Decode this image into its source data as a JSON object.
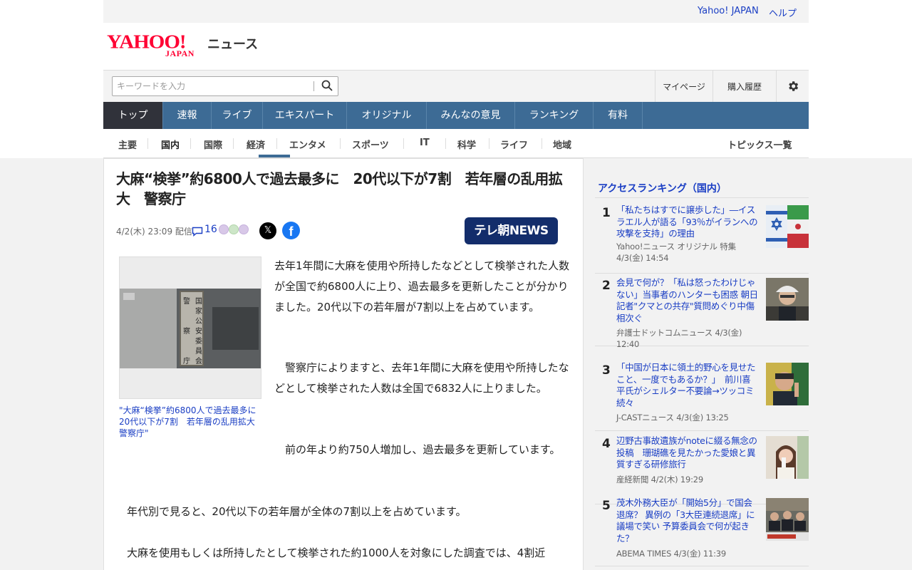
{
  "utility_links": [
    "Yahoo! JAPAN",
    "ヘルプ"
  ],
  "logo": {
    "yahoo": "YAHOO!",
    "japan": "JAPAN",
    "service": "ニュース"
  },
  "search": {
    "placeholder": "キーワードを入力",
    "icon": "search-icon"
  },
  "header_links": [
    "マイページ",
    "購入履歴"
  ],
  "settings_icon": "gear-icon",
  "main_nav": [
    "トップ",
    "速報",
    "ライブ",
    "エキスパート",
    "オリジナル",
    "みんなの意見",
    "ランキング",
    "有料"
  ],
  "main_nav_active": "トップ",
  "sub_nav": [
    "主要",
    "国内",
    "国際",
    "経済",
    "エンタメ",
    "スポーツ",
    "IT",
    "科学",
    "ライフ",
    "地域"
  ],
  "sub_nav_active": "国内",
  "topics_link": "トピックス一覧",
  "article": {
    "headline": "大麻“検挙”約6800人で過去最多に　20代以下が7割　若年層の乱用拡大　警察庁",
    "date": "4/2(木) 23:09 配信",
    "comment_count": "16",
    "media": "テレ朝NEWS",
    "caption": "\"大麻“検挙”約6800人で過去最多に　20代以下が7割　若年層の乱用拡大　警察庁\"",
    "paragraphs": [
      "去年1年間に大麻を使用や所持したなどとして検挙された人数が全国で約6800人に上り、過去最多を更新したことが分かりました。20代以下の若年層が7割以上を占めています。",
      "警察庁によりますと、去年1年間に大麻を使用や所持したなどとして検挙された人数は全国で6832人に上りました。",
      "前の年より約750人増加し、過去最多を更新しています。",
      "年代別で見ると、20代以下の若年層が全体の7割以上を占めています。",
      "大麻を使用もしくは所持したとして検挙された約1000人を対象にした調査では、4割近"
    ]
  },
  "ranking": {
    "title": "アクセスランキング（国内）",
    "items": [
      {
        "rank": "1",
        "title": "「私たちはすでに譲歩した」―イスラエル人が語る「93％がイランへの攻撃を支持」の理由",
        "source": "Yahoo!ニュース オリジナル 特集",
        "time": "4/3(金) 14:54"
      },
      {
        "rank": "2",
        "title": "会見で何が？「私は怒ったわけじゃない」当事者のハンターも困惑 朝日記者\"クマとの共存\"質問めぐり中傷相次ぐ",
        "source": "弁護士ドットコムニュース 4/3(金)",
        "time": "12:40"
      },
      {
        "rank": "3",
        "title": "「中国が日本に領土的野心を見せたこと、一度でもあるか？」　前川喜平氏がシェルター不要論→ツッコミ続々",
        "source": "J-CASTニュース 4/3(金) 13:25",
        "time": ""
      },
      {
        "rank": "4",
        "title": "辺野古事故遺族がnoteに綴る無念の投稿　珊瑚礁を見たかった愛娘と異質すぎる研修旅行",
        "source": "産経新聞 4/2(木) 19:29",
        "time": ""
      },
      {
        "rank": "5",
        "title": "茂木外務大臣が「開始5分」で国会退席？ 異例の「3大臣連続退席」に議場で笑い 予算委員会で何が起きた？",
        "source": "ABEMA TIMES 4/3(金) 11:39",
        "time": ""
      }
    ]
  }
}
